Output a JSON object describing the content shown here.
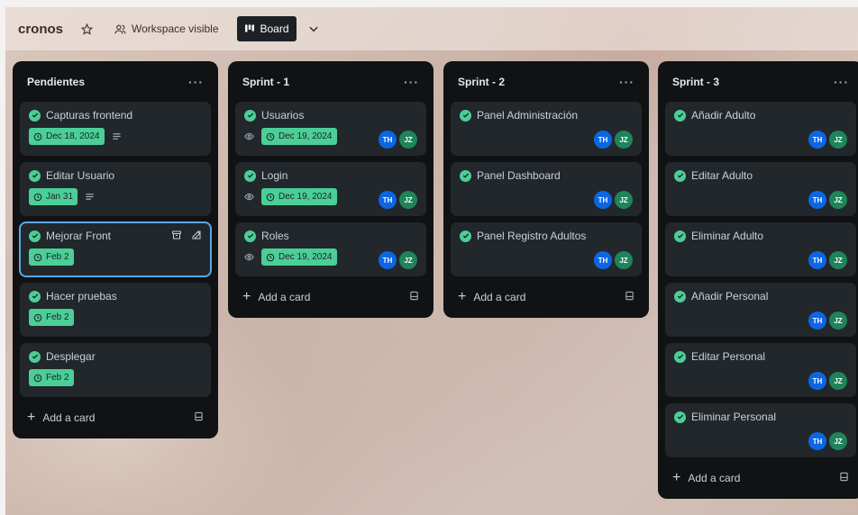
{
  "header": {
    "board_name": "cronos",
    "visibility_label": "Workspace visible",
    "view_label": "Board"
  },
  "colors": {
    "list_bg": "#111214",
    "card_bg": "#22272b",
    "complete_green": "#4bce97",
    "avatar_th": "#0c66e4",
    "avatar_jz": "#1f845a",
    "selected_outline": "#5aa8e6"
  },
  "lists": [
    {
      "title": "Pendientes",
      "add_label": "Add a card",
      "cards": [
        {
          "title": "Capturas frontend",
          "due": "Dec 18, 2024"
        },
        {
          "title": "Editar Usuario",
          "due": "Jan 31"
        },
        {
          "title": "Mejorar Front",
          "due": "Feb 2"
        },
        {
          "title": "Hacer pruebas",
          "due": "Feb 2"
        },
        {
          "title": "Desplegar",
          "due": "Feb 2"
        }
      ]
    },
    {
      "title": "Sprint - 1",
      "add_label": "Add a card",
      "cards": [
        {
          "title": "Usuarios",
          "due": "Dec 19, 2024",
          "members": [
            "TH",
            "JZ"
          ]
        },
        {
          "title": "Login",
          "due": "Dec 19, 2024",
          "members": [
            "TH",
            "JZ"
          ]
        },
        {
          "title": "Roles",
          "due": "Dec 19, 2024",
          "members": [
            "TH",
            "JZ"
          ]
        }
      ]
    },
    {
      "title": "Sprint - 2",
      "add_label": "Add a card",
      "cards": [
        {
          "title": "Panel Administración",
          "members": [
            "TH",
            "JZ"
          ]
        },
        {
          "title": "Panel Dashboard",
          "members": [
            "TH",
            "JZ"
          ]
        },
        {
          "title": "Panel Registro Adultos",
          "members": [
            "TH",
            "JZ"
          ]
        }
      ]
    },
    {
      "title": "Sprint - 3",
      "add_label": "Add a card",
      "cards": [
        {
          "title": "Añadir Adulto",
          "members": [
            "TH",
            "JZ"
          ]
        },
        {
          "title": "Editar Adulto",
          "members": [
            "TH",
            "JZ"
          ]
        },
        {
          "title": "Eliminar Adulto",
          "members": [
            "TH",
            "JZ"
          ]
        },
        {
          "title": "Añadir Personal",
          "members": [
            "TH",
            "JZ"
          ]
        },
        {
          "title": "Editar Personal",
          "members": [
            "TH",
            "JZ"
          ]
        },
        {
          "title": "Eliminar Personal",
          "members": [
            "TH",
            "JZ"
          ]
        }
      ]
    }
  ]
}
